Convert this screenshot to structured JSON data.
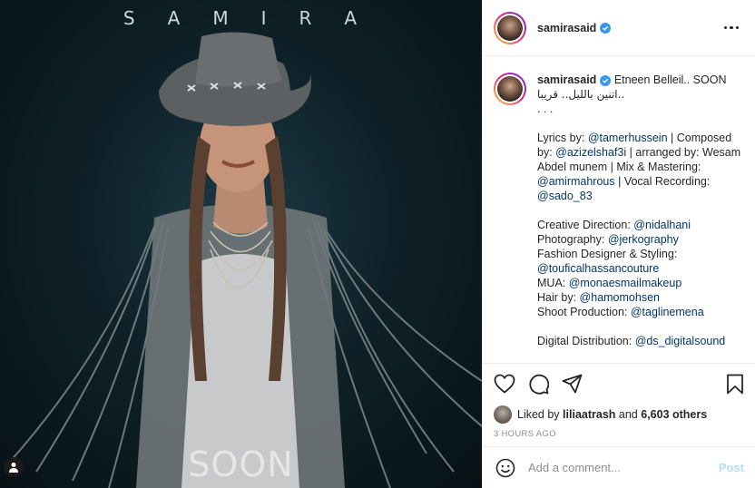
{
  "photo": {
    "artist_letters": [
      "S",
      "A",
      "M",
      "I",
      "R",
      "A"
    ],
    "soon_text": "SOON"
  },
  "header": {
    "username": "samirasaid",
    "verified_icon": "verified-badge-icon",
    "more_icon": "more-options-icon"
  },
  "caption": {
    "username": "samirasaid",
    "line1": "Etneen Belleil.. SOON",
    "arabic": "..اتنين بالليل.. قريبا",
    "dots": ". . .",
    "lyrics_label": "Lyrics by: ",
    "lyrics_handle": "@tamerhussein",
    "composed_label": " | Composed by: ",
    "composed_handle": "@azizelshaf3i",
    "arranged_label": " | arranged by: Wesam Abdel munem | Mix & Mastering: ",
    "mastering_handle": "@amirmahrous",
    "vocal_label": " | Vocal Recording: ",
    "vocal_handle": "@sado_83",
    "creative_label": "Creative Direction: ",
    "creative_handle": "@nidalhani",
    "photo_label": "Photography: ",
    "photo_handle": "@jerkography",
    "fashion_label": "Fashion Designer & Styling:",
    "fashion_handle": "@toufica lhassancouture",
    "fashion_handle_exact": "@touficalhassancouture",
    "mua_label": "MUA: ",
    "mua_handle": "@monaesmailmakeup",
    "hair_label": "Hair by: ",
    "hair_handle": "@hamomohsen",
    "shoot_label": "Shoot Production: ",
    "shoot_handle": "@taglinemena",
    "digital_label": "Digital Distribution: ",
    "digital_handle": "@ds_digitalsound"
  },
  "actions": {
    "like_icon": "heart-icon",
    "comment_icon": "comment-icon",
    "share_icon": "share-icon",
    "save_icon": "bookmark-icon"
  },
  "likes": {
    "prefix": "Liked by ",
    "user": "liliaatrash",
    "middle": " and ",
    "count": "6,603 others"
  },
  "time": "3 HOURS AGO",
  "comment_bar": {
    "placeholder": "Add a comment...",
    "post_label": "Post",
    "emoji_icon": "emoji-icon"
  },
  "colors": {
    "link": "#00376b",
    "verified": "#3897f0",
    "post_button_disabled": "#b2dffc",
    "muted": "#8e8e8e"
  }
}
